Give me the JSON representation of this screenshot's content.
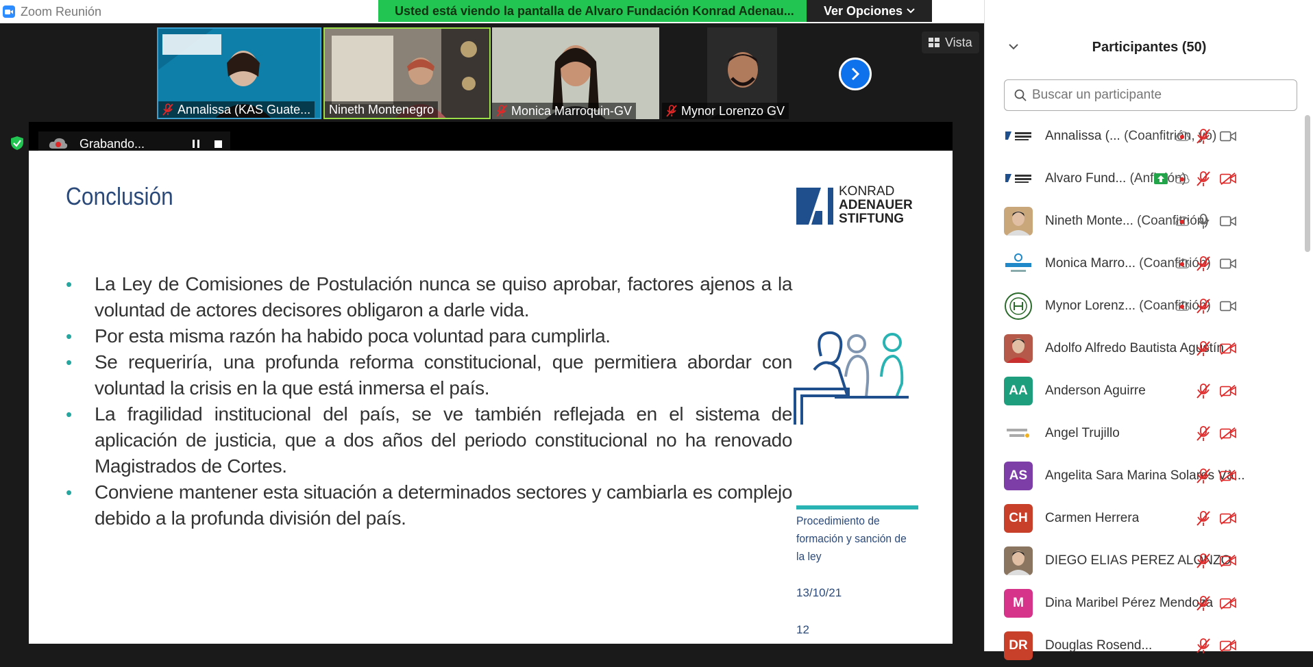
{
  "window": {
    "title": "Zoom Reunión"
  },
  "banner": {
    "text": "Usted está viendo la pantalla de Alvaro Fundación Konrad Adenau...",
    "options_label": "Ver Opciones"
  },
  "video_strip": {
    "view_label": "Vista",
    "tiles": [
      {
        "name": "Annalissa (KAS Guate...",
        "muted": true
      },
      {
        "name": "Nineth Montenegro",
        "muted": false
      },
      {
        "name": "Monica Marroquin-GV",
        "muted": true
      },
      {
        "name": "Mynor Lorenzo GV",
        "muted": true
      }
    ]
  },
  "recording": {
    "label": "Grabando..."
  },
  "slide": {
    "title": "Conclusión",
    "logo_lines": [
      "KONRAD",
      "ADENAUER",
      "STIFTUNG"
    ],
    "bullets": [
      "La Ley de Comisiones de Postulación nunca se quiso aprobar, factores ajenos a la voluntad de actores decisores obligaron a darle vida.",
      "Por esta misma razón ha habido poca voluntad para cumplirla.",
      "Se requeriría, una profunda reforma constitucional, que permitiera abordar con voluntad la crisis en la que está inmersa el país.",
      "La fragilidad institucional del país, se ve también reflejada en el sistema de aplicación de justicia, que a dos años del periodo constitucional no ha renovado Magistrados de Cortes.",
      "Conviene mantener esta situación a determinados sectores y cambiarla es complejo debido a la profunda división del país."
    ],
    "footer_title": "Procedimiento de formación y sanción de la ley",
    "footer_date": "13/10/21",
    "footer_page": "12"
  },
  "panel": {
    "title": "Participantes (50)",
    "search_placeholder": "Buscar un participante",
    "participants": [
      {
        "name": "Annalissa (...",
        "role": "(Coanfitrión, yo)",
        "avatar": "KAS",
        "avatar_color": "#ffffff",
        "recording": true,
        "mic": "off",
        "video": "on"
      },
      {
        "name": "Alvaro Fund...",
        "role": "(Anfitrión)",
        "avatar": "KAS",
        "avatar_color": "#ffffff",
        "sharing": true,
        "recording": true,
        "mic": "off",
        "video": "off"
      },
      {
        "name": "Nineth Monte...",
        "role": "(Coanfitrión)",
        "avatar": "photo",
        "avatar_color": "#c9a77a",
        "recording": true,
        "mic": "on",
        "video": "on"
      },
      {
        "name": "Monica Marro...",
        "role": "(Coanfitrión)",
        "avatar": "GV",
        "avatar_color": "#ffffff",
        "recording": true,
        "mic": "off",
        "video": "on"
      },
      {
        "name": "Mynor Lorenz...",
        "role": "(Coanfitrión)",
        "avatar": "seal",
        "avatar_color": "#ffffff",
        "recording": true,
        "mic": "off",
        "video": "on"
      },
      {
        "name": "Adolfo Alfredo Bautista Agustín",
        "role": "",
        "avatar": "photo",
        "avatar_color": "#b55a4a",
        "mic": "off",
        "video": "off"
      },
      {
        "name": "Anderson Aguirre",
        "role": "",
        "avatar": "AA",
        "avatar_color": "#1f9e7e",
        "mic": "off",
        "video": "off"
      },
      {
        "name": "Angel Trujillo",
        "role": "",
        "avatar": "logo",
        "avatar_color": "#ffffff",
        "mic": "off",
        "video": "off"
      },
      {
        "name": "Angelita Sara Marina Solares Và...",
        "role": "",
        "avatar": "AS",
        "avatar_color": "#7d3ea8",
        "mic": "off",
        "video": "off"
      },
      {
        "name": "Carmen Herrera",
        "role": "",
        "avatar": "CH",
        "avatar_color": "#c8402a",
        "mic": "off",
        "video": "off"
      },
      {
        "name": "DIEGO ELIAS PEREZ ALONZO",
        "role": "",
        "avatar": "photo",
        "avatar_color": "#8a7560",
        "mic": "off",
        "video": "off"
      },
      {
        "name": "Dina Maribel Pérez Mendoza",
        "role": "",
        "avatar": "M",
        "avatar_color": "#d6338a",
        "mic": "off",
        "video": "off"
      },
      {
        "name": "Douglas Rosend...",
        "role": "",
        "avatar": "DR",
        "avatar_color": "#c8402a",
        "mic": "off",
        "video": "off"
      }
    ]
  },
  "colors": {
    "accent": "#2d8cff",
    "banner_green": "#23c552",
    "muted_red": "#e02828",
    "slide_blue": "#2b4a7a",
    "slide_teal": "#29b3b3"
  }
}
